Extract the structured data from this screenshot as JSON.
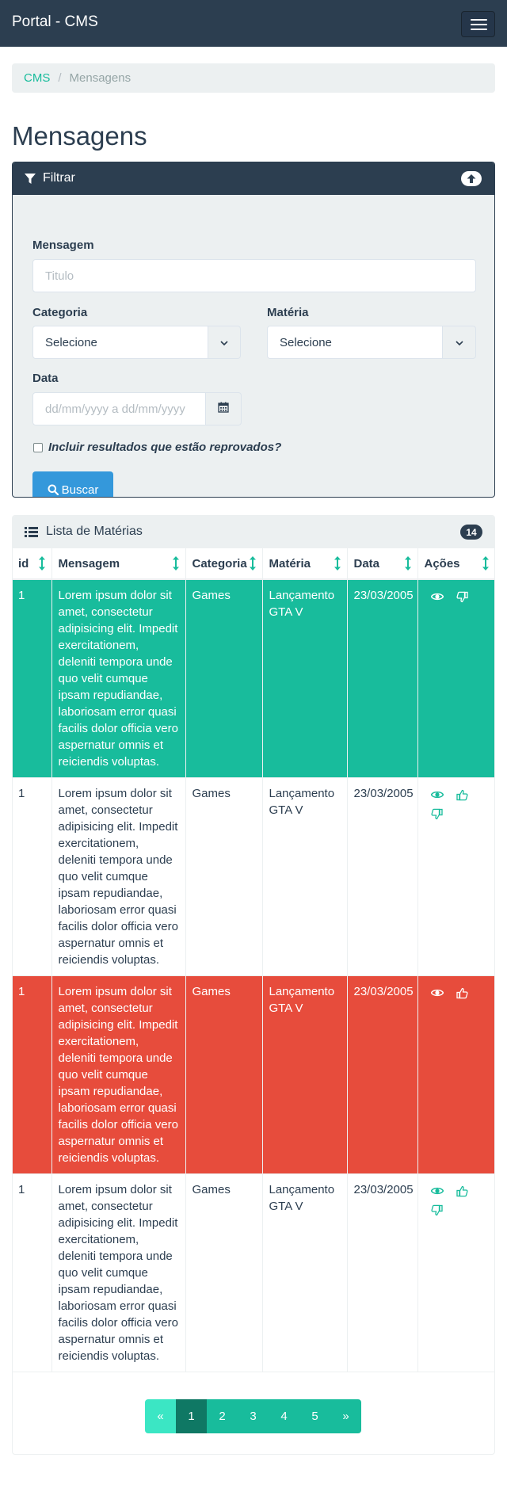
{
  "navbar": {
    "brand": "Portal - CMS",
    "toggle_icon": "hamburger-menu-icon"
  },
  "breadcrumb": {
    "items": [
      "CMS",
      "Mensagens"
    ],
    "separator": "/"
  },
  "page_title": "Mensagens",
  "filter": {
    "title": "Filtrar",
    "mensagem_label": "Mensagem",
    "mensagem_placeholder": "Titulo",
    "categoria_label": "Categoria",
    "categoria_value": "Selecione",
    "materia_label": "Matéria",
    "materia_value": "Selecione",
    "data_label": "Data",
    "data_placeholder": "dd/mm/yyyy a dd/mm/yyyy",
    "include_rejected_label": "Incluir resultados que estão reprovados?",
    "include_rejected_checked": false,
    "search_label": "Buscar"
  },
  "list": {
    "title": "Lista de Matérias",
    "count": "14",
    "columns": [
      "id",
      "Mensagem",
      "Categoria",
      "Matéria",
      "Data",
      "Ações"
    ],
    "rows": [
      {
        "status": "approved",
        "id": "1",
        "mensagem": "Lorem ipsum dolor sit amet, consectetur adipisicing elit. Impedit exercitationem, deleniti tempora unde quo velit cumque ipsam repudiandae, laboriosam error quasi facilis dolor officia vero aspernatur omnis et reiciendis voluptas.",
        "categoria": "Games",
        "materia": "Lançamento GTA V",
        "data": "23/03/2005",
        "actions": [
          "eye-icon",
          "thumbs-down-icon"
        ]
      },
      {
        "status": "pending",
        "id": "1",
        "mensagem": "Lorem ipsum dolor sit amet, consectetur adipisicing elit. Impedit exercitationem, deleniti tempora unde quo velit cumque ipsam repudiandae, laboriosam error quasi facilis dolor officia vero aspernatur omnis et reiciendis voluptas.",
        "categoria": "Games",
        "materia": "Lançamento GTA V",
        "data": "23/03/2005",
        "actions": [
          "eye-icon",
          "thumbs-up-icon",
          "thumbs-down-icon"
        ]
      },
      {
        "status": "rejected",
        "id": "1",
        "mensagem": "Lorem ipsum dolor sit amet, consectetur adipisicing elit. Impedit exercitationem, deleniti tempora unde quo velit cumque ipsam repudiandae, laboriosam error quasi facilis dolor officia vero aspernatur omnis et reiciendis voluptas.",
        "categoria": "Games",
        "materia": "Lançamento GTA V",
        "data": "23/03/2005",
        "actions": [
          "eye-icon",
          "thumbs-up-icon"
        ]
      },
      {
        "status": "pending",
        "id": "1",
        "mensagem": "Lorem ipsum dolor sit amet, consectetur adipisicing elit. Impedit exercitationem, deleniti tempora unde quo velit cumque ipsam repudiandae, laboriosam error quasi facilis dolor officia vero aspernatur omnis et reiciendis voluptas.",
        "categoria": "Games",
        "materia": "Lançamento GTA V",
        "data": "23/03/2005",
        "actions": [
          "eye-icon",
          "thumbs-up-icon",
          "thumbs-down-icon"
        ]
      }
    ]
  },
  "pagination": {
    "prev": "«",
    "pages": [
      "1",
      "2",
      "3",
      "4",
      "5"
    ],
    "next": "»",
    "current": "1"
  },
  "colors": {
    "primary": "#2c3e50",
    "success": "#18bc9c",
    "danger": "#e74c3c",
    "info": "#3498db",
    "light": "#ecf0f1"
  }
}
